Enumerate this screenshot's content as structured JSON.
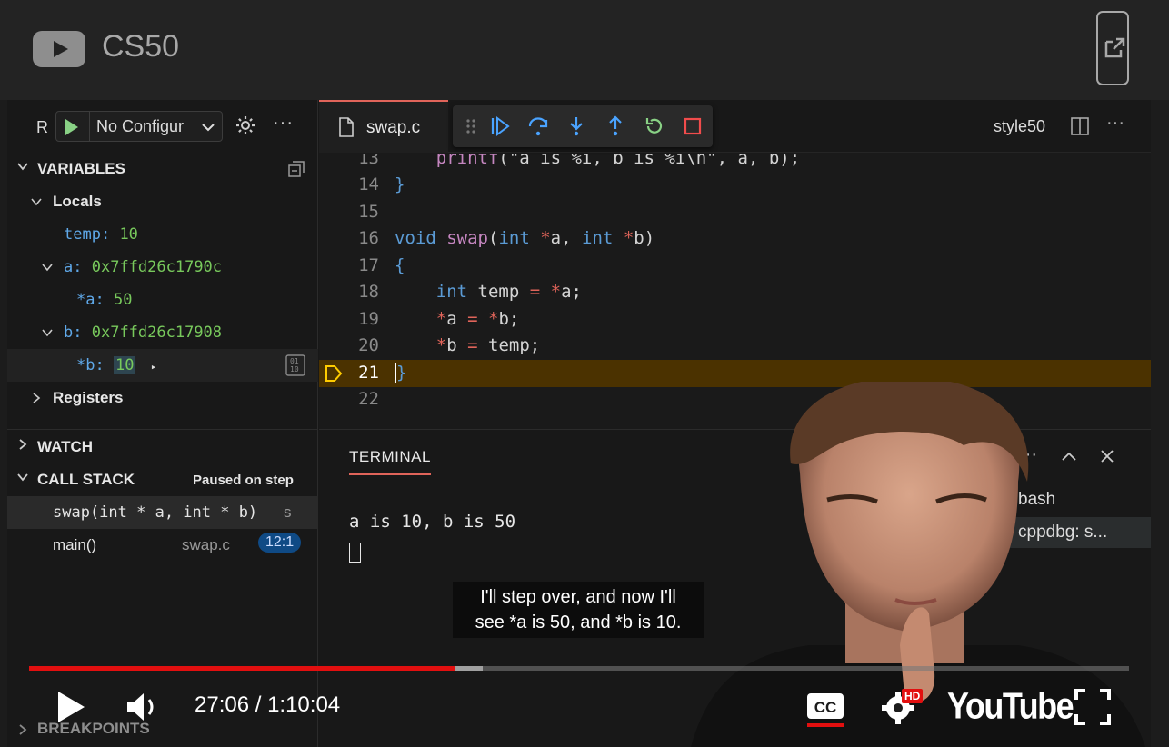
{
  "youtube": {
    "channel_name": "CS50",
    "time_display": "27:06 / 1:10:04",
    "progress_played": 0.387,
    "progress_buffered": 0.412,
    "hd_badge": "HD",
    "wordmark": "YouTube",
    "captions": [
      "I'll step over, and now I'll",
      "see *a is 50, and *b is 10."
    ]
  },
  "run_toolbar": {
    "run_label": "R",
    "config_label": "No Configur"
  },
  "variables": {
    "header": "VARIABLES",
    "locals_label": "Locals",
    "items": [
      {
        "name": "temp:",
        "value": "10"
      },
      {
        "name": "a:",
        "value": "0x7ffd26c1790c"
      },
      {
        "name": "*a:",
        "value": "50"
      },
      {
        "name": "b:",
        "value": "0x7ffd26c17908"
      },
      {
        "name": "*b:",
        "value": "10"
      }
    ],
    "registers_label": "Registers"
  },
  "watch": {
    "header": "WATCH"
  },
  "call_stack": {
    "header": "CALL STACK",
    "status": "Paused on step",
    "frames": [
      {
        "name": "swap(int * a, int * b)",
        "file": "s"
      },
      {
        "name": "main()",
        "file": "swap.c",
        "badge": "12:1"
      }
    ]
  },
  "breakpoints": {
    "header": "BREAKPOINTS"
  },
  "editor": {
    "tab_label": "swap.c",
    "right_label": "style50",
    "lines": [
      {
        "n": "13"
      },
      {
        "n": "14"
      },
      {
        "n": "15"
      },
      {
        "n": "16"
      },
      {
        "n": "17"
      },
      {
        "n": "18"
      },
      {
        "n": "19"
      },
      {
        "n": "20"
      },
      {
        "n": "21"
      },
      {
        "n": "22"
      }
    ]
  },
  "terminal": {
    "tab_label": "TERMINAL",
    "output": "a is 10, b is 50",
    "sessions": [
      "bash",
      "cppdbg: s..."
    ]
  },
  "colors": {
    "accent_red": "#e20f0f",
    "tab_accent": "#e0645a",
    "current_line": "#4b3200",
    "variable_value": "#78c95c",
    "variable_name": "#5fa8e8"
  }
}
